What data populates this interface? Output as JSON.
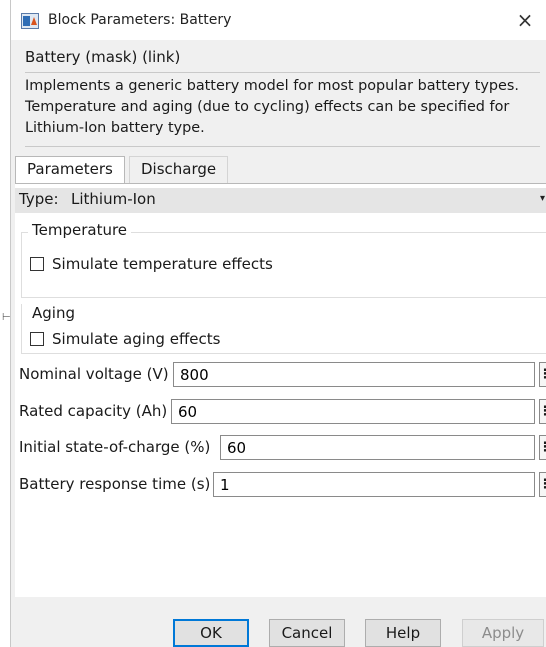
{
  "window": {
    "title": "Block Parameters: Battery",
    "close_glyph": "×",
    "icon": "simulink-block-icon"
  },
  "mask": {
    "title": "Battery (mask) (link)",
    "description": "Implements a generic battery model for most popular battery types. Temperature and aging (due to cycling) effects can be specified for Lithium-Ion battery type."
  },
  "tabs": [
    {
      "label": "Parameters",
      "active": true
    },
    {
      "label": "Discharge",
      "active": false
    }
  ],
  "type": {
    "label": "Type:",
    "value": "Lithium-Ion",
    "caret": "▾"
  },
  "temperature": {
    "legend": "Temperature",
    "checkbox_label": "Simulate temperature effects",
    "checked": false
  },
  "aging": {
    "legend": "Aging",
    "checkbox_label": "Simulate aging effects",
    "checked": false
  },
  "params": [
    {
      "label": "Nominal voltage (V)",
      "value": "800"
    },
    {
      "label": "Rated capacity (Ah)",
      "value": "60"
    },
    {
      "label": "Initial state-of-charge (%)",
      "value": "60"
    },
    {
      "label": "Battery response time (s)",
      "value": "1"
    }
  ],
  "menu_glyph": "⋮",
  "buttons": {
    "ok": "OK",
    "cancel": "Cancel",
    "help": "Help",
    "apply": "Apply"
  },
  "colors": {
    "accent": "#0078d7",
    "dialog_bg": "#f0f0f0"
  }
}
